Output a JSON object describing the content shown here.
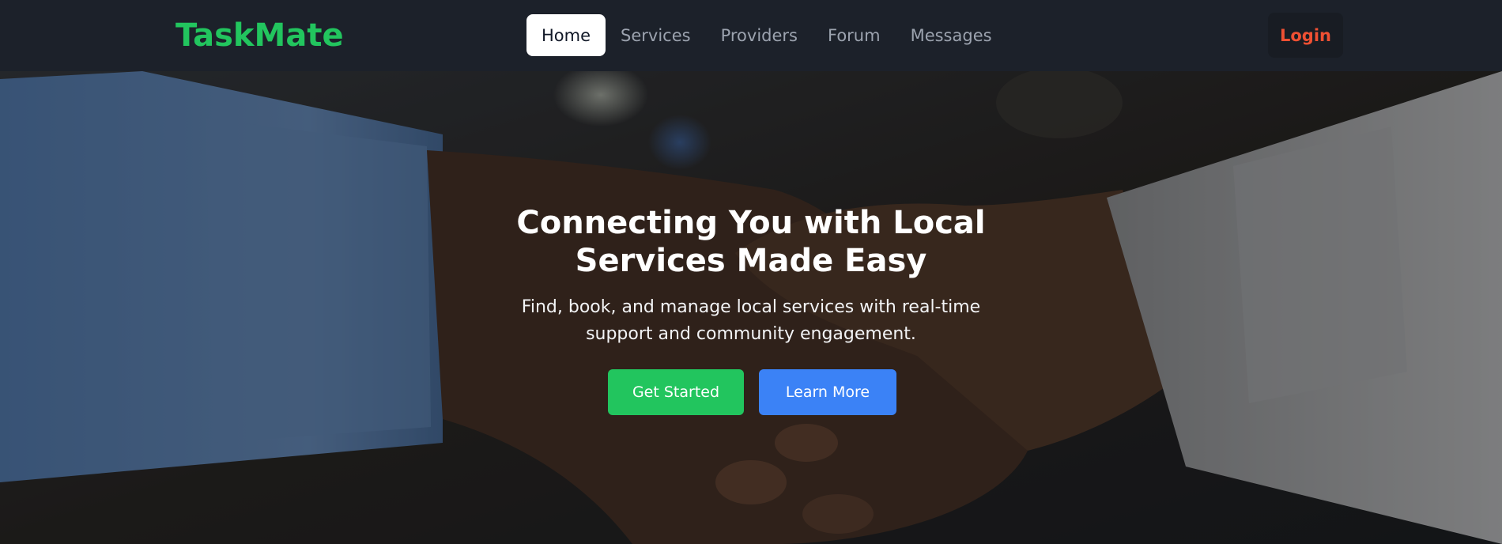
{
  "header": {
    "brand": "TaskMate",
    "nav": [
      {
        "label": "Home",
        "active": true
      },
      {
        "label": "Services",
        "active": false
      },
      {
        "label": "Providers",
        "active": false
      },
      {
        "label": "Forum",
        "active": false
      },
      {
        "label": "Messages",
        "active": false
      }
    ],
    "login_label": "Login"
  },
  "hero": {
    "title": "Connecting You with Local Services Made Easy",
    "subtitle": "Find, book, and manage local services with real-time support and community engagement.",
    "primary_button": "Get Started",
    "secondary_button": "Learn More",
    "background_image": "handshake-photo"
  },
  "colors": {
    "brand": "#22c55e",
    "login": "#ef5033",
    "primary_button": "#22c55e",
    "secondary_button": "#3b82f6",
    "nav_bg": "#1c212a"
  }
}
